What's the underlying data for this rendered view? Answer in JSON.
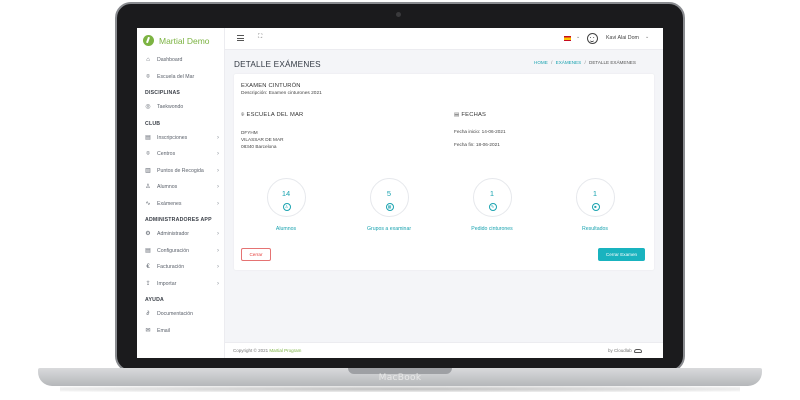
{
  "device": {
    "brand": "MacBook"
  },
  "app": {
    "name": "Martial Demo",
    "brand_color": "#7cb342",
    "accent_color": "#1aa3b0"
  },
  "sidebar": {
    "top_items": [
      {
        "label": "Dashboard",
        "icon": "home-icon"
      },
      {
        "label": "Escuela del Mar",
        "icon": "location-pin-icon"
      }
    ],
    "sections": [
      {
        "title": "DISCIPLINAS",
        "items": [
          {
            "label": "Taekwondo",
            "icon": "target-icon",
            "chevron": false
          }
        ]
      },
      {
        "title": "CLUB",
        "items": [
          {
            "label": "Inscripciones",
            "icon": "document-icon",
            "chevron": true
          },
          {
            "label": "Centros",
            "icon": "location-pin-icon",
            "chevron": true
          },
          {
            "label": "Puntos de Recogida",
            "icon": "map-icon",
            "chevron": true
          },
          {
            "label": "Alumnos",
            "icon": "users-icon",
            "chevron": true
          },
          {
            "label": "Exámenes",
            "icon": "activity-icon",
            "chevron": true
          }
        ]
      },
      {
        "title": "ADMINISTRADORES APP",
        "items": [
          {
            "label": "Administrador",
            "icon": "gear-icon",
            "chevron": true
          },
          {
            "label": "Configuración",
            "icon": "document-icon",
            "chevron": true
          },
          {
            "label": "Facturación",
            "icon": "euro-icon",
            "chevron": true
          },
          {
            "label": "Importar",
            "icon": "upload-icon",
            "chevron": true
          }
        ]
      },
      {
        "title": "AYUDA",
        "items": [
          {
            "label": "Documentación",
            "icon": "paperclip-icon",
            "chevron": false
          },
          {
            "label": "Email",
            "icon": "mail-icon",
            "chevron": false
          }
        ]
      }
    ]
  },
  "topbar": {
    "language_flag": "spain-flag-icon",
    "user_name": "Kavi Alai Dom"
  },
  "header": {
    "page_title": "DETALLE EXÁMENES",
    "breadcrumb": {
      "home": "HOME",
      "link": "EXÁMENES",
      "current": "DETALLE EXÁMENES"
    }
  },
  "exam": {
    "title": "EXAMEN CINTURÓN",
    "description": "Descripción: Examen cinturones 2021",
    "school_heading": "ESCUELA DEL MAR",
    "address": [
      "DFYHM",
      "VILASSAR DE MAR",
      "08340 Barcelona"
    ],
    "dates_heading": "FECHAS",
    "start_date": "Fecha inicio: 14-06-2021",
    "end_date": "Fecha fin: 18-06-2021"
  },
  "stats": [
    {
      "value": "14",
      "label": "Alumnos",
      "icon": "user-icon"
    },
    {
      "value": "5",
      "label": "Grupos a examinar",
      "icon": "calendar-icon"
    },
    {
      "value": "1",
      "label": "Pedido cinturones",
      "icon": "edit-icon"
    },
    {
      "value": "1",
      "label": "Resultados",
      "icon": "lock-icon"
    }
  ],
  "buttons": {
    "close": "Cerrar",
    "close_exam": "Cerrar Examen"
  },
  "footer": {
    "copyright_prefix": "Copyright © 2021",
    "copyright_brand": "Martial Program",
    "by": "by Cloudlab"
  }
}
